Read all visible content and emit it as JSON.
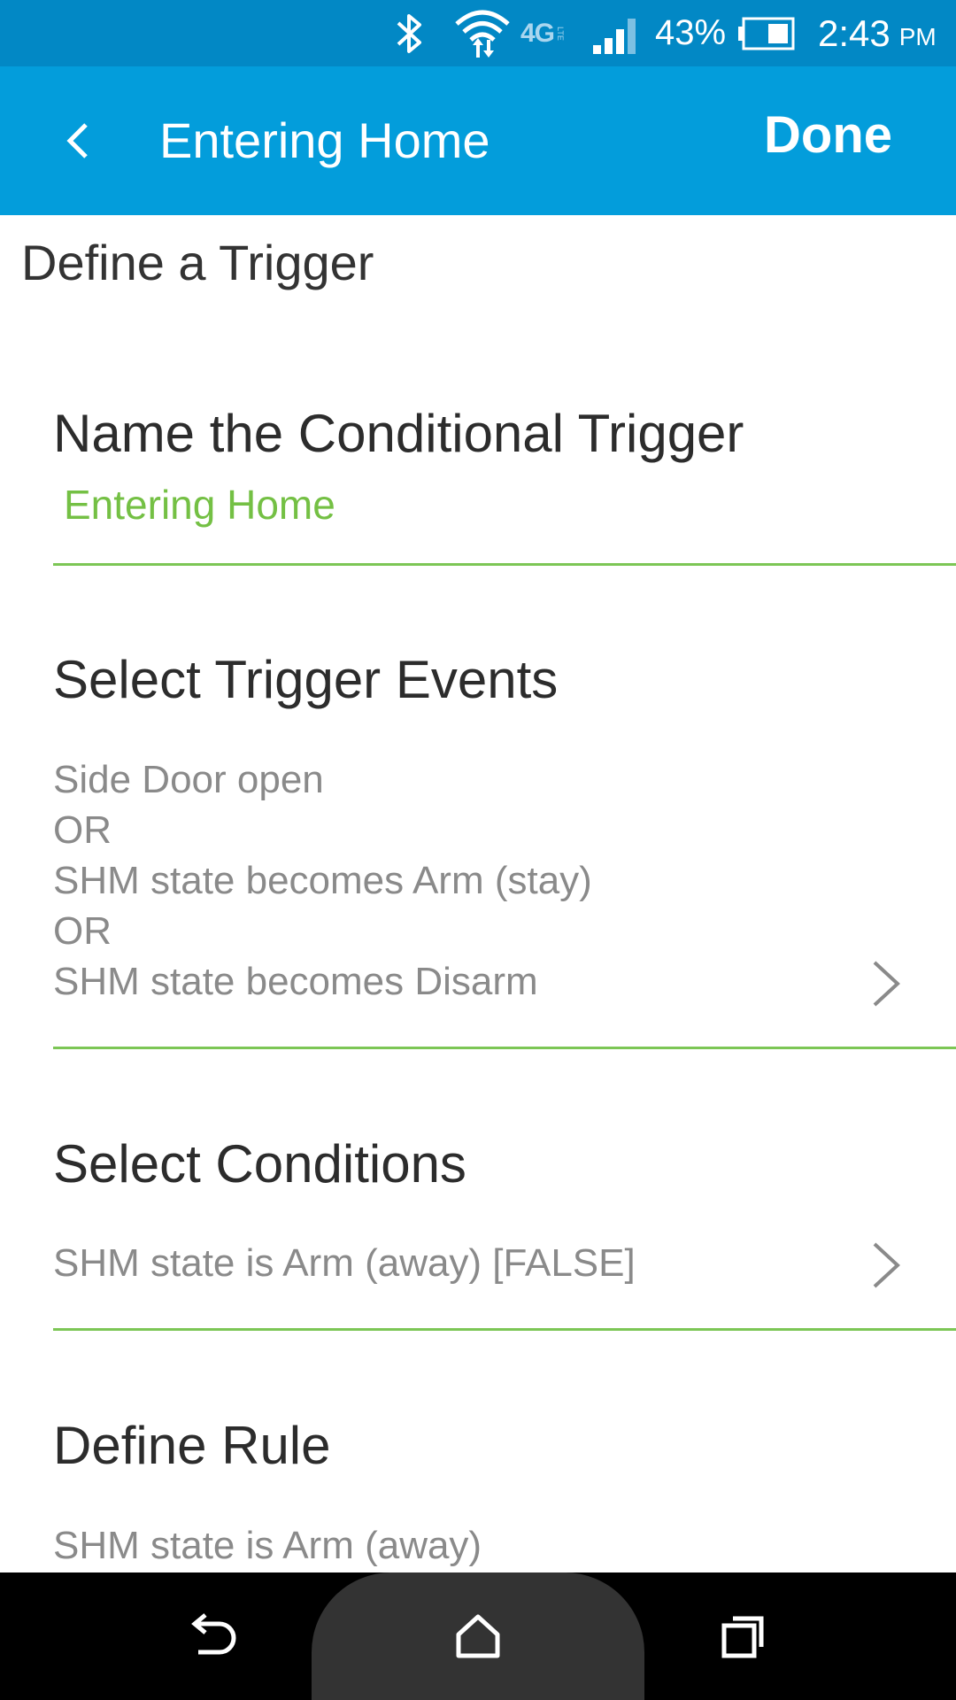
{
  "status_bar": {
    "battery_percent": "43%",
    "time": "2:43",
    "ampm": "PM",
    "network": "4G",
    "network_sub": "LTE"
  },
  "app_bar": {
    "title": "Entering Home",
    "done_label": "Done"
  },
  "page": {
    "heading": "Define a Trigger"
  },
  "name_section": {
    "title": "Name the Conditional Trigger",
    "value": "Entering Home"
  },
  "events_section": {
    "title": "Select Trigger Events",
    "lines": [
      "Side Door open",
      "OR",
      "SHM state becomes Arm (stay)",
      "OR",
      "SHM state becomes Disarm"
    ]
  },
  "conditions_section": {
    "title": "Select Conditions",
    "value": "SHM state is Arm (away) [FALSE]"
  },
  "rule_section": {
    "title": "Define Rule",
    "value": "SHM state is Arm (away)"
  },
  "colors": {
    "status_bar": "#0288c5",
    "app_bar": "#039ddb",
    "accent_green": "#74c044",
    "divider_green": "#7cc655",
    "secondary_text": "#8a8a8a"
  },
  "icons": [
    "bluetooth-icon",
    "wifi-icon",
    "signal-icon",
    "battery-icon",
    "back-arrow-icon",
    "chevron-right-icon",
    "nav-back-icon",
    "nav-home-icon",
    "nav-recents-icon"
  ]
}
